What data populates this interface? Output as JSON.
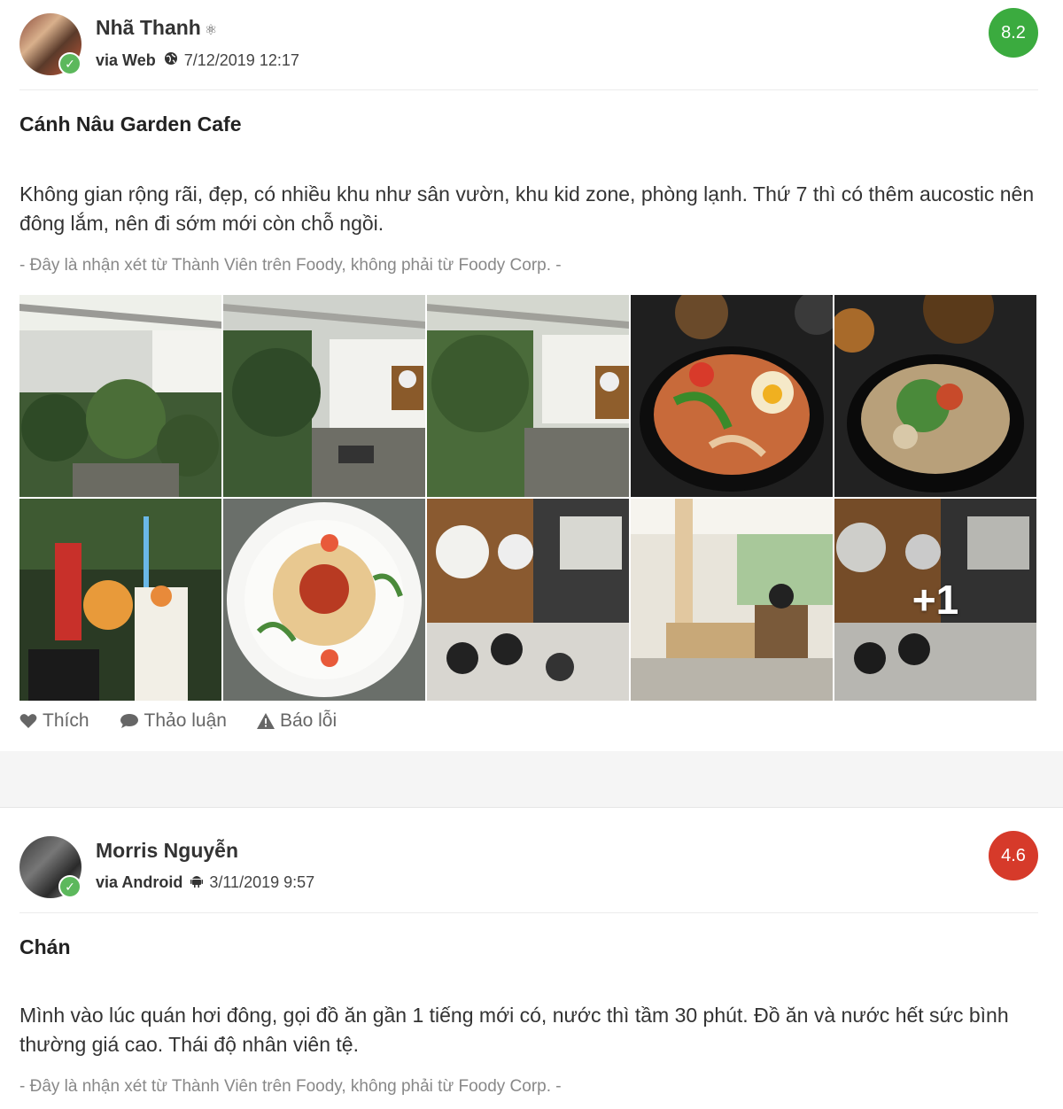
{
  "reviews": [
    {
      "user_name": "Nhã Thanh",
      "user_badge": "⚛",
      "via": "via Web",
      "platform_icon": "globe-icon",
      "date": "7/12/2019 12:17",
      "score": "8.2",
      "score_color": "#3bab3f",
      "title": "Cánh Nâu Garden Cafe",
      "text": "Không gian rộng rãi, đẹp, có nhiều khu như sân vườn, khu kid zone, phòng lạnh. Thứ 7 thì có thêm aucostic nên đông lắm, nên đi sớm mới còn chỗ ngồi.",
      "disclaimer": "- Đây là nhận xét từ Thành Viên trên Foody, không phải từ Foody Corp. -",
      "photos": [
        {
          "subject": "garden-courtyard"
        },
        {
          "subject": "garden-courtyard"
        },
        {
          "subject": "garden-courtyard"
        },
        {
          "subject": "noodle-dish"
        },
        {
          "subject": "noodle-soup-bowl"
        },
        {
          "subject": "drinks"
        },
        {
          "subject": "spaghetti-plate"
        },
        {
          "subject": "acoustic-performance"
        },
        {
          "subject": "indoor-seating"
        },
        {
          "subject": "acoustic-performance"
        }
      ],
      "more_photos": "+1",
      "actions": {
        "like": "Thích",
        "discuss": "Thảo luận",
        "report": "Báo lỗi"
      }
    },
    {
      "user_name": "Morris Nguyễn",
      "via": "via Android",
      "platform_icon": "android-icon",
      "date": "3/11/2019 9:57",
      "score": "4.6",
      "score_color": "#d63a2a",
      "title": "Chán",
      "text": "Mình vào lúc quán hơi đông, gọi đồ ăn gần 1 tiếng mới có, nước thì tầm 30 phút. Đồ ăn và nước hết sức bình thường giá cao. Thái độ nhân viên tệ.",
      "disclaimer": "- Đây là nhận xét từ Thành Viên trên Foody, không phải từ Foody Corp. -"
    }
  ]
}
